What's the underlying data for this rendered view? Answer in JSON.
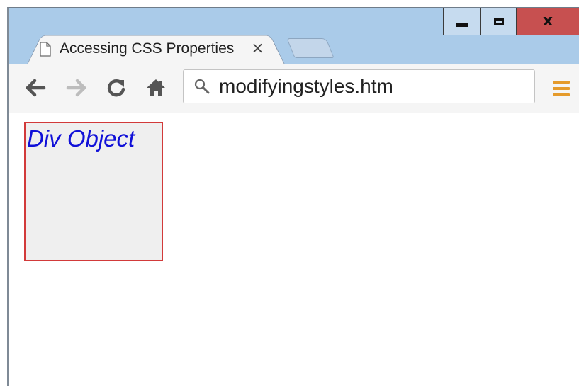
{
  "window": {
    "controls": {
      "minimize_icon": "minimize-icon",
      "maximize_icon": "maximize-icon",
      "close_label": "x"
    }
  },
  "tab": {
    "title": "Accessing CSS Properties",
    "close_label": "×",
    "page_icon": "page-icon"
  },
  "toolbar": {
    "back_icon": "back-arrow-icon",
    "forward_icon": "forward-arrow-icon",
    "reload_icon": "reload-icon",
    "home_icon": "home-icon",
    "url": "modifyingstyles.htm",
    "search_icon": "search-icon",
    "menu_icon": "hamburger-menu-icon"
  },
  "page": {
    "div_object_text": "Div Object"
  },
  "colors": {
    "titlebar": "#aacbe9",
    "close_button": "#c75050",
    "div_border": "#d23a3a",
    "div_background": "#efefef",
    "div_text": "#1010d8",
    "menu_icon": "#e59b2c"
  }
}
